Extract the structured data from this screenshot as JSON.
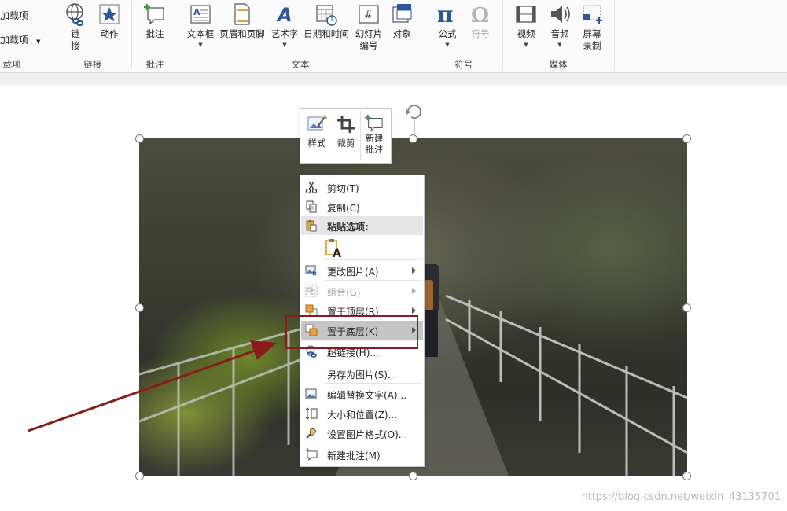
{
  "ribbon": {
    "left_items": [
      "加载项",
      "加载项"
    ],
    "left_group": "载项",
    "groups": [
      {
        "label": "链接",
        "buttons": [
          {
            "label": "链",
            "label2": "接",
            "icon": "globe-link-icon"
          },
          {
            "label": "动作",
            "icon": "star-action-icon"
          }
        ]
      },
      {
        "label": "批注",
        "buttons": [
          {
            "label": "批注",
            "icon": "comment-icon"
          }
        ]
      },
      {
        "label": "文本",
        "buttons": [
          {
            "label": "文本框",
            "icon": "textbox-icon"
          },
          {
            "label": "页眉和页脚",
            "icon": "header-footer-icon"
          },
          {
            "label": "艺术字",
            "icon": "wordart-icon"
          },
          {
            "label": "日期和时间",
            "icon": "calendar-clock-icon"
          },
          {
            "label": "幻灯片",
            "label2": "编号",
            "icon": "slide-number-icon"
          },
          {
            "label": "对象",
            "icon": "object-icon"
          }
        ]
      },
      {
        "label": "符号",
        "buttons": [
          {
            "label": "公式",
            "icon": "pi-icon"
          },
          {
            "label": "符号",
            "icon": "omega-icon"
          }
        ]
      },
      {
        "label": "媒体",
        "buttons": [
          {
            "label": "视频",
            "icon": "video-icon"
          },
          {
            "label": "音频",
            "icon": "speaker-icon"
          },
          {
            "label": "屏幕",
            "label2": "录制",
            "icon": "screen-record-icon"
          }
        ]
      }
    ]
  },
  "mini_toolbar": {
    "style": "样式",
    "crop": "裁剪",
    "new_comment_1": "新建",
    "new_comment_2": "批注"
  },
  "context_menu": {
    "items": [
      {
        "label": "剪切(T)",
        "icon": "scissors-icon"
      },
      {
        "label": "复制(C)",
        "icon": "copy-icon"
      },
      {
        "label": "粘贴选项:",
        "icon": "paste-icon"
      },
      {
        "label": "更改图片(A)",
        "icon": "change-picture-icon"
      },
      {
        "label": "组合(G)",
        "icon": "group-icon"
      },
      {
        "label": "置于顶层(R)",
        "icon": "bring-to-front-icon"
      },
      {
        "label": "置于底层(K)",
        "icon": "send-to-back-icon"
      },
      {
        "label": "超链接(H)...",
        "icon": "hyperlink-icon"
      },
      {
        "label": "另存为图片(S)...",
        "icon": ""
      },
      {
        "label": "编辑替换文字(A)...",
        "icon": "alt-text-icon"
      },
      {
        "label": "大小和位置(Z)...",
        "icon": "size-position-icon"
      },
      {
        "label": "设置图片格式(O)...",
        "icon": "format-picture-icon"
      },
      {
        "label": "新建批注(M)",
        "icon": "new-comment-icon"
      }
    ],
    "paste_glyph": "A"
  },
  "watermark": "https://blog.csdn.net/weixin_43135701",
  "colors": {
    "callout": "#8b1a1a",
    "highlight": "#c5c5c5",
    "accent_blue": "#2b579a"
  }
}
